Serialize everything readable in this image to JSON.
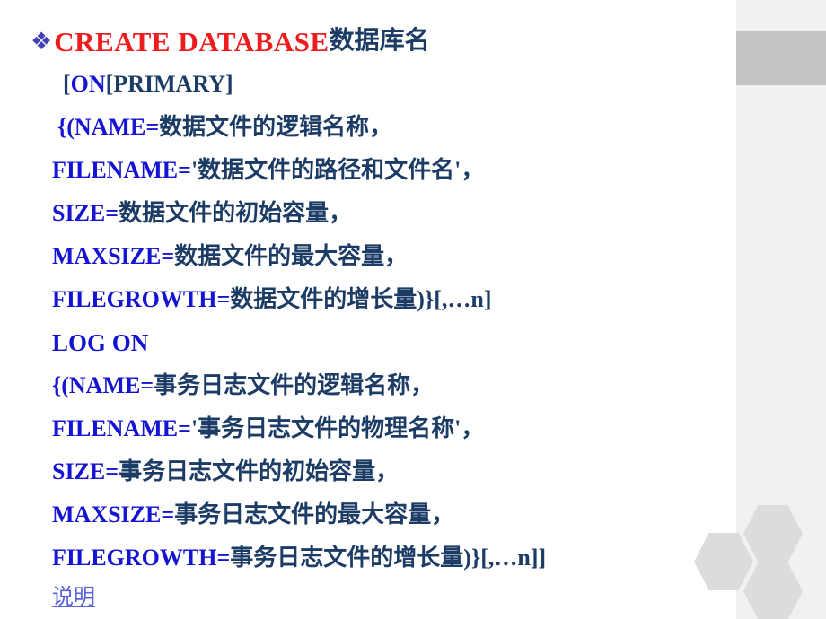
{
  "slide": {
    "title": "CREATE DATABASE syntax slide",
    "background_color": "#ffffff",
    "decor": {
      "band_color": "#f1f1f1",
      "block_color": "#c4c4c4",
      "hexagon_color": "#dcdcdc",
      "hexagon_count": 3
    },
    "colors": {
      "keyword_red": "#ee1c1c",
      "keyword_blue": "#1414d2",
      "chinese_navy": "#1c3c66",
      "hyperlink_blue": "#5b63d8",
      "bullet_blue": "#4242b5"
    }
  },
  "content": {
    "bullet_glyph": "❖",
    "line1": {
      "keyword": "CREATE   DATABASE",
      "argument": "数据库名"
    },
    "line2": {
      "open_bracket": "[",
      "keyword": "ON",
      "rest": "  [PRIMARY]"
    },
    "line3": {
      "keyword": "{(NAME=",
      "argument": "数据文件的逻辑名称，"
    },
    "line4": {
      "keyword": "FILENAME=",
      "argument": "'数据文件的路径和文件名'，"
    },
    "line5": {
      "keyword": "SIZE=",
      "argument": "数据文件的初始容量，"
    },
    "line6": {
      "keyword": "MAXSIZE=",
      "argument": "数据文件的最大容量，"
    },
    "line7": {
      "keyword": "FILEGROWTH=",
      "argument": "数据文件的增长量)",
      "tail": "}[,…n]"
    },
    "line8": {
      "keyword": "LOG ON"
    },
    "line9": {
      "keyword": "{(NAME=",
      "argument": "事务日志文件的逻辑名称，"
    },
    "line10": {
      "keyword": "FILENAME=",
      "argument": "'事务日志文件的物理名称'，"
    },
    "line11": {
      "keyword": "SIZE=",
      "argument": "事务日志文件的初始容量，"
    },
    "line12": {
      "keyword": "MAXSIZE=",
      "argument": "事务日志文件的最大容量，"
    },
    "line13": {
      "keyword": "FILEGROWTH=",
      "argument": "事务日志文件的增长量)",
      "tail": " }[,…n]]"
    },
    "line14": {
      "link_label": "说明"
    }
  }
}
